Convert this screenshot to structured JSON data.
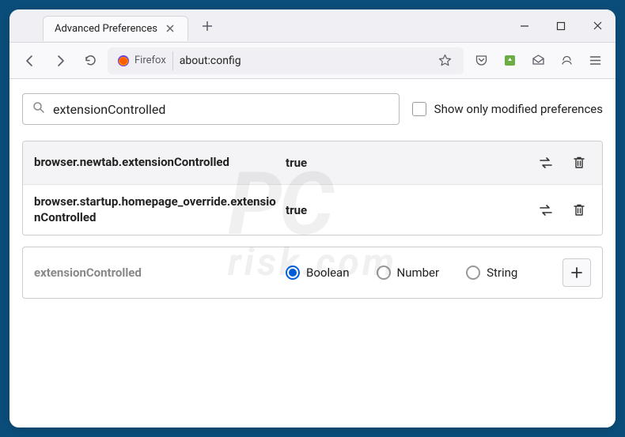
{
  "titlebar": {
    "tab_title": "Advanced Preferences"
  },
  "toolbar": {
    "identity_label": "Firefox",
    "url": "about:config"
  },
  "search": {
    "value": "extensionControlled",
    "checkbox_label": "Show only modified preferences"
  },
  "prefs": [
    {
      "name": "browser.newtab.extensionControlled",
      "value": "true"
    },
    {
      "name": "browser.startup.homepage_override.extensionControlled",
      "value": "true"
    }
  ],
  "new_pref": {
    "name": "extensionControlled",
    "types": [
      "Boolean",
      "Number",
      "String"
    ],
    "selected": "Boolean"
  },
  "watermark": {
    "main": "PC",
    "sub": "risk.com"
  }
}
